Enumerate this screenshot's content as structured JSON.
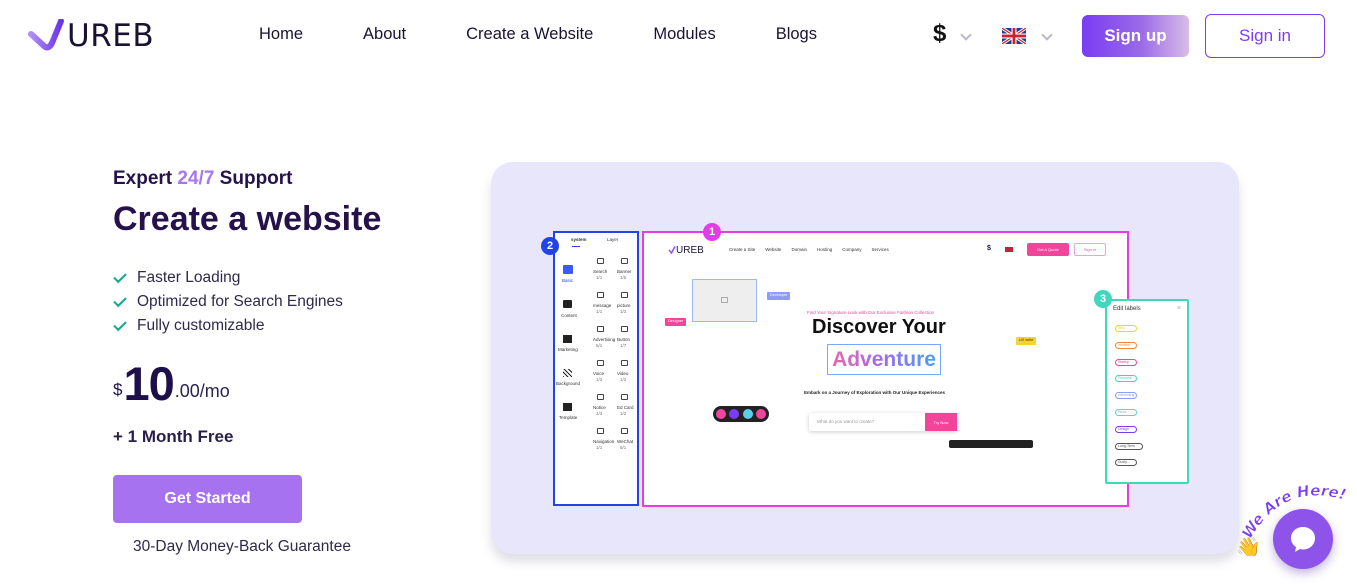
{
  "brand": {
    "name": "UREB"
  },
  "nav": {
    "items": [
      "Home",
      "About",
      "Create a Website",
      "Modules",
      "Blogs"
    ],
    "currency": "$",
    "language_flag": "uk-flag-icon",
    "signup_label": "Sign up",
    "signin_label": "Sign in"
  },
  "hero": {
    "eyebrow_prefix": "Expert ",
    "eyebrow_highlight": "24/7",
    "eyebrow_suffix": " Support",
    "title": "Create a website",
    "features": [
      "Faster Loading",
      "Optimized for Search Engines",
      "Fully customizable"
    ],
    "price": {
      "currency": "$",
      "amount": "10",
      "suffix": ".00/mo"
    },
    "bonus": "+ 1 Month Free",
    "cta_label": "Get Started",
    "guarantee": "30-Day Money-Back Guarantee"
  },
  "illustration": {
    "step_numbers": [
      "1",
      "2",
      "3"
    ],
    "panel_tabs": [
      "system",
      "Layer"
    ],
    "categories": [
      "Basic",
      "Content",
      "Marketing",
      "Background",
      "Template"
    ],
    "widgets": [
      {
        "name": "Search",
        "count": "1/1"
      },
      {
        "name": "Banner",
        "count": "1/5"
      },
      {
        "name": "message",
        "count": "1/1"
      },
      {
        "name": "picture",
        "count": "1/3"
      },
      {
        "name": "Advertising",
        "count": "6/1"
      },
      {
        "name": "Button",
        "count": "1/7"
      },
      {
        "name": "Voice",
        "count": "1/3"
      },
      {
        "name": "Video",
        "count": "1/3"
      },
      {
        "name": "Notice",
        "count": "1/3"
      },
      {
        "name": "Ed Card",
        "count": "1/2"
      },
      {
        "name": "Navigation",
        "count": "1/1"
      },
      {
        "name": "WeChat",
        "count": "8/1"
      }
    ],
    "mini_brand": "UREB",
    "mini_nav": [
      "Create a Site",
      "Website",
      "Domain",
      "Hosting",
      "Company",
      "Services"
    ],
    "mini_currency": "$",
    "mini_quote": "Get A Quote",
    "mini_signin": "Sign in",
    "tagline": "Find Your Signature Look with Our Exclusive Fashion Collection",
    "headline1": "Discover Your",
    "headline2": "Adventure",
    "subline": "Embark on a Journey of Exploration with Our Unique Experiences",
    "search_placeholder": "What do you want to create?",
    "try_label": "Try Now",
    "floating_tags": [
      "Developer",
      "Designer",
      "UX write"
    ],
    "labels_title": "Edit labels",
    "labels": [
      "Idea",
      "Intuitive",
      "Startup",
      "Personal",
      "Interesting",
      "Ideas",
      "Design",
      "Long-Term",
      "Dusty..."
    ]
  },
  "chat": {
    "badge": "We Are Here!"
  }
}
